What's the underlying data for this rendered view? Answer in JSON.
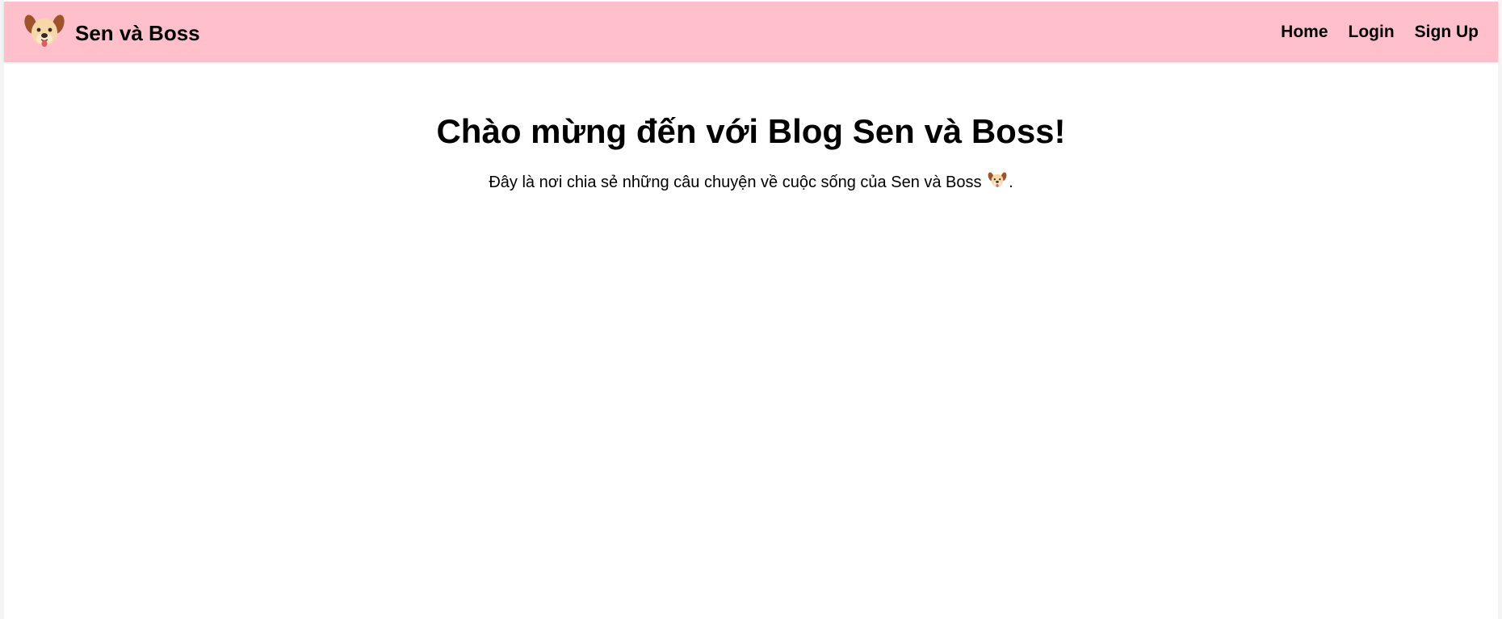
{
  "navbar": {
    "brand_name": "Sen và Boss",
    "logo_icon": "dog-face-icon",
    "background_color": "#ffc0cb",
    "links": [
      {
        "label": "Home"
      },
      {
        "label": "Login"
      },
      {
        "label": "Sign Up"
      }
    ]
  },
  "main": {
    "title": "Chào mừng đến với Blog Sen và Boss!",
    "intro_text": "Đây là nơi chia sẻ những câu chuyện về cuộc sống của Sen và Boss",
    "intro_icon": "dog-face-icon",
    "intro_suffix": "."
  }
}
